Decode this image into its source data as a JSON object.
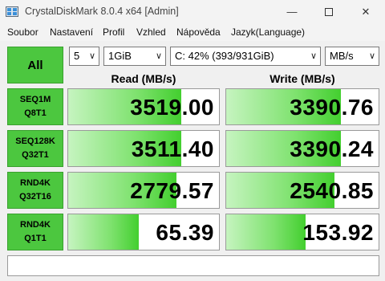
{
  "window": {
    "title": "CrystalDiskMark 8.0.4 x64 [Admin]",
    "minimize": "—",
    "close": "✕"
  },
  "menu": [
    "Soubor",
    "Nastavení",
    "Profil",
    "Vzhled",
    "Nápověda",
    "Jazyk(Language)"
  ],
  "controls": {
    "all_label": "All",
    "count": "5",
    "size": "1GiB",
    "drive": "C: 42% (393/931GiB)",
    "unit": "MB/s"
  },
  "headers": {
    "read": "Read (MB/s)",
    "write": "Write (MB/s)"
  },
  "tests": [
    {
      "line1": "SEQ1M",
      "line2": "Q8T1",
      "read": "3519.00",
      "write": "3390.76",
      "read_fill": 0.75,
      "write_fill": 0.75
    },
    {
      "line1": "SEQ128K",
      "line2": "Q32T1",
      "read": "3511.40",
      "write": "3390.24",
      "read_fill": 0.75,
      "write_fill": 0.75
    },
    {
      "line1": "RND4K",
      "line2": "Q32T16",
      "read": "2779.57",
      "write": "2540.85",
      "read_fill": 0.72,
      "write_fill": 0.71
    },
    {
      "line1": "RND4K",
      "line2": "Q1T1",
      "read": "65.39",
      "write": "153.92",
      "read_fill": 0.47,
      "write_fill": 0.52
    }
  ],
  "colors": {
    "accent_green": "#4cc73f",
    "bar_green": "#43cf2f"
  }
}
